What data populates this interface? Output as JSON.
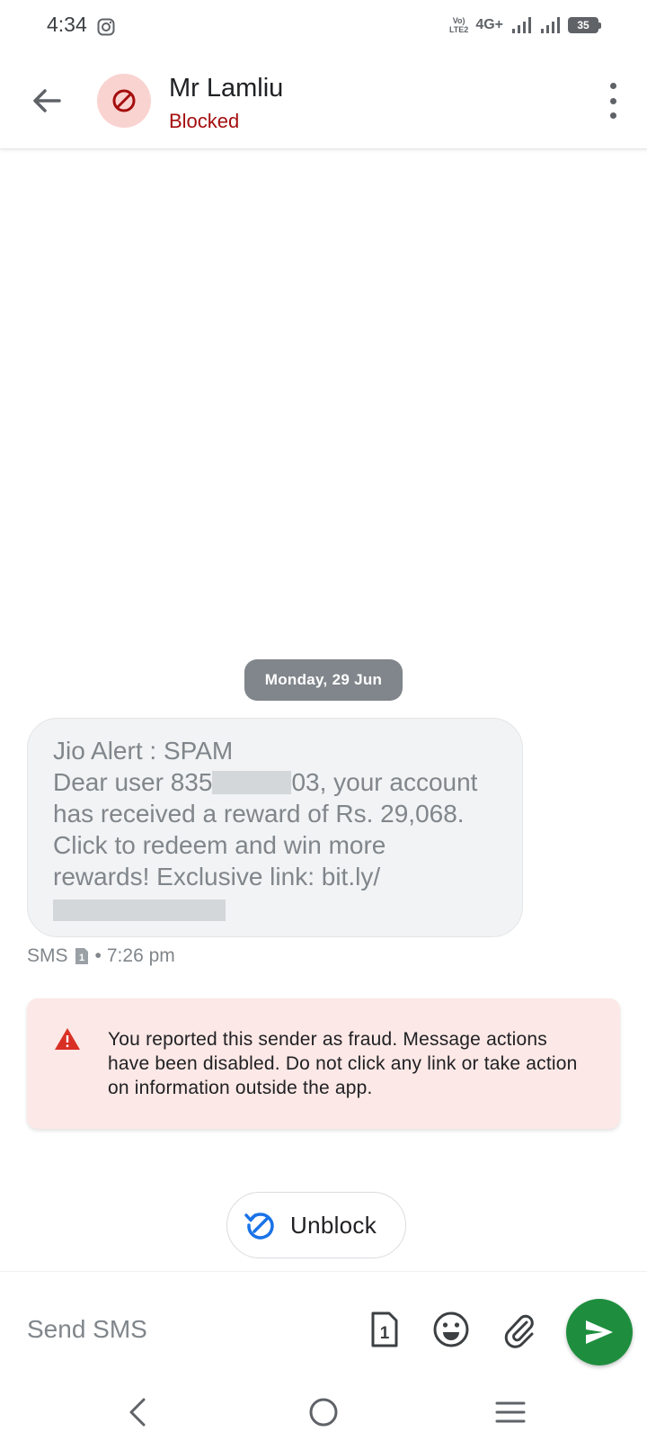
{
  "status_bar": {
    "time": "4:34",
    "volte_line1": "Vo)",
    "volte_line2": "LTE2",
    "network": "4G+",
    "battery": "35"
  },
  "header": {
    "contact_name": "Mr Lamliu",
    "contact_status": "Blocked"
  },
  "conversation": {
    "date_chip": "Monday, 29 Jun",
    "message": {
      "line1": "Jio Alert : SPAM",
      "line2_pre": "Dear user 835",
      "line2_post": "03, your account",
      "line3": "has received a reward of Rs. 29,068.",
      "line4": "Click to redeem and win more",
      "line5": "rewards! Exclusive link: bit.ly/",
      "meta_type": "SMS",
      "meta_sep": "•",
      "meta_time": "7:26 pm"
    },
    "warning": {
      "text": "You reported this sender as fraud. Message actions have been disabled. Do not click any link or take action on information outside the app."
    },
    "unblock_label": "Unblock"
  },
  "compose": {
    "placeholder": "Send SMS",
    "sim_number": "1"
  },
  "colors": {
    "blocked_red": "#a50e0e",
    "send_green": "#1e8e3e",
    "warning_bg": "#fce8e6",
    "unblock_blue": "#1a73e8"
  }
}
